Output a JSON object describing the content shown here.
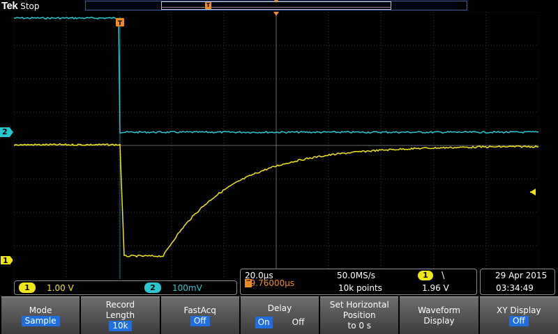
{
  "header": {
    "brand": "Tek",
    "run_state": "Stop"
  },
  "record_bar": {
    "trigger_label": "T"
  },
  "channels": {
    "ch1": {
      "label": "1",
      "scale": "1.00 V",
      "color": "#f0e614"
    },
    "ch2": {
      "label": "2",
      "scale": "100mV",
      "color": "#28c8d2"
    }
  },
  "acquisition": {
    "timebase": "20.0µs",
    "sample_rate": "50.0MS/s",
    "trigger_badge": "T",
    "trigger_position": "59.76000µs",
    "record_points": "10k points",
    "trigger_source": "1",
    "trigger_slope": "\\",
    "trigger_level": "1.96 V"
  },
  "datetime": {
    "date": "29 Apr  2015",
    "time": "03:34:49"
  },
  "softkeys": {
    "mode": {
      "label": "Mode",
      "value": "Sample"
    },
    "record_length": {
      "label_line1": "Record",
      "label_line2": "Length",
      "value": "10k"
    },
    "fastacq": {
      "label": "FastAcq",
      "value": "Off"
    },
    "delay": {
      "label": "Delay",
      "on": "On",
      "off": "Off"
    },
    "set_horizontal": {
      "line1": "Set Horizontal",
      "line2": "Position",
      "line3": "to 0 s"
    },
    "waveform_display": {
      "line1": "Waveform",
      "line2": "Display"
    },
    "xy_display": {
      "label": "XY Display",
      "value": "Off"
    }
  },
  "colors": {
    "trigger": "#f08c1e",
    "accent": "#1f6fe0"
  }
}
